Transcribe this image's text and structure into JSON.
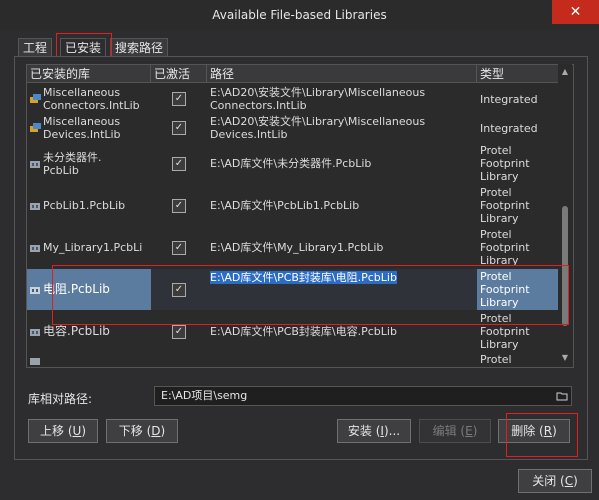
{
  "window": {
    "title": "Available File-based Libraries",
    "close_label": "✕"
  },
  "tabs": [
    {
      "label": "工程",
      "active": false
    },
    {
      "label": "已安装",
      "active": true
    },
    {
      "label": "搜索路径",
      "active": false
    }
  ],
  "table": {
    "headers": [
      "已安装的库",
      "已激活",
      "路径",
      "类型"
    ],
    "rows": [
      {
        "name": "Miscellaneous\nConnectors.IntLib",
        "icon": "integrated-lib-icon",
        "active": true,
        "path": "E:\\AD20\\安装文件\\Library\\Miscellaneous\nConnectors.IntLib",
        "type": "Integrated",
        "selected": false
      },
      {
        "name": "Miscellaneous\nDevices.IntLib",
        "icon": "integrated-lib-icon",
        "active": true,
        "path": "E:\\AD20\\安装文件\\Library\\Miscellaneous\nDevices.IntLib",
        "type": "Integrated",
        "selected": false
      },
      {
        "name": "未分类器件.\nPcbLib",
        "icon": "pcb-lib-icon",
        "active": true,
        "path": "E:\\AD库文件\\未分类器件.PcbLib",
        "type": "Protel\nFootprint\nLibrary",
        "selected": false
      },
      {
        "name": "PcbLib1.PcbLib",
        "icon": "pcb-lib-icon",
        "active": true,
        "path": "E:\\AD库文件\\PcbLib1.PcbLib",
        "type": "Protel\nFootprint\nLibrary",
        "selected": false
      },
      {
        "name": "My_Library1.PcbLi",
        "icon": "pcb-lib-icon",
        "active": true,
        "path": "E:\\AD库文件\\My_Library1.PcbLib",
        "type": "Protel\nFootprint\nLibrary",
        "selected": false
      },
      {
        "name": "电阻.PcbLib",
        "icon": "pcb-lib-icon",
        "active": true,
        "path": "E:\\AD库文件\\PCB封装库\\电阻.PcbLib",
        "type": "Protel\nFootprint\nLibrary",
        "selected": true
      },
      {
        "name": "电容.PcbLib",
        "icon": "pcb-lib-icon",
        "active": true,
        "path": "E:\\AD库文件\\PCB封装库\\电容.PcbLib",
        "type": "Protel\nFootprint\nLibrary",
        "selected": false
      },
      {
        "name": "",
        "icon": "pcb-lib-icon",
        "active": true,
        "path": "",
        "type": "Protel",
        "selected": false
      }
    ]
  },
  "relative_path": {
    "label": "库相对路径:",
    "value": "E:\\AD项目\\semg"
  },
  "buttons": {
    "move_up": {
      "label": "上移",
      "key": "U"
    },
    "move_down": {
      "label": "下移",
      "key": "D"
    },
    "install": {
      "label": "安装",
      "key": "I",
      "suffix": "..."
    },
    "edit": {
      "label": "编辑",
      "key": "E"
    },
    "remove": {
      "label": "删除",
      "key": "R"
    },
    "close": {
      "label": "关闭",
      "key": "C"
    }
  }
}
